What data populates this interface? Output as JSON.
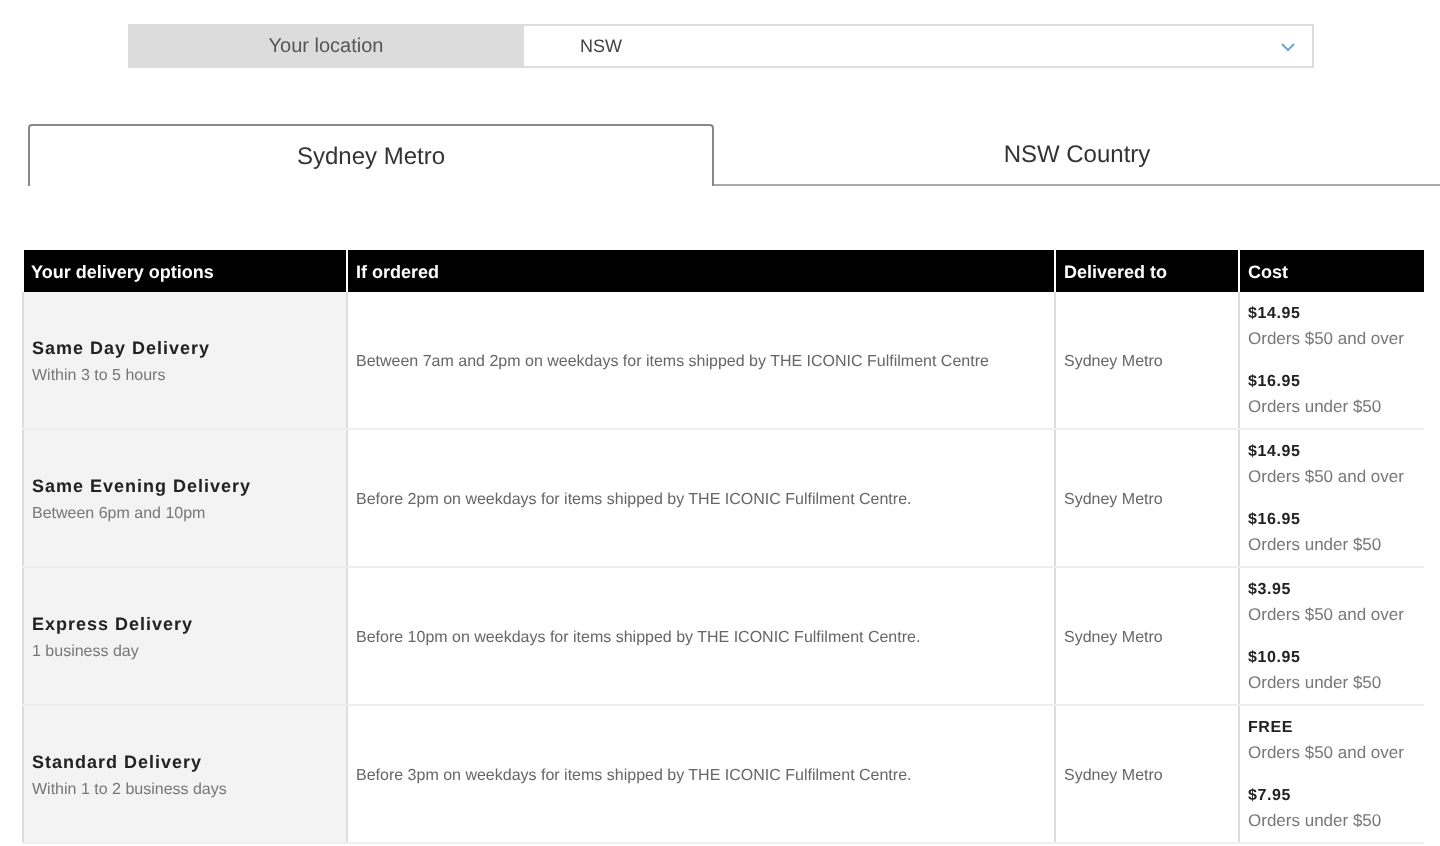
{
  "location": {
    "label": "Your location",
    "value": "NSW"
  },
  "tabs": [
    {
      "label": "Sydney Metro",
      "selected": true
    },
    {
      "label": "NSW Country",
      "selected": false
    }
  ],
  "table": {
    "columns": [
      "Your delivery options",
      "If ordered",
      "Delivered to",
      "Cost"
    ],
    "rows": [
      {
        "option": "Same Day Delivery",
        "timeframe": "Within 3 to 5 hours",
        "if_ordered": "Between 7am and 2pm on weekdays for items shipped by THE ICONIC Fulfilment Centre",
        "delivered_to": "Sydney Metro",
        "costs": [
          {
            "price": "$14.95",
            "condition": "Orders $50 and over"
          },
          {
            "price": "$16.95",
            "condition": "Orders under $50"
          }
        ]
      },
      {
        "option": "Same Evening Delivery",
        "timeframe": "Between 6pm and 10pm",
        "if_ordered": "Before 2pm on weekdays for items shipped by THE ICONIC Fulfilment Centre.",
        "delivered_to": "Sydney Metro",
        "costs": [
          {
            "price": "$14.95",
            "condition": "Orders $50 and over"
          },
          {
            "price": "$16.95",
            "condition": "Orders under $50"
          }
        ]
      },
      {
        "option": "Express Delivery",
        "timeframe": "1 business day",
        "if_ordered": "Before 10pm on weekdays for items shipped by THE ICONIC Fulfilment Centre.",
        "delivered_to": "Sydney Metro",
        "costs": [
          {
            "price": "$3.95",
            "condition": "Orders $50 and over"
          },
          {
            "price": "$10.95",
            "condition": "Orders under $50"
          }
        ]
      },
      {
        "option": "Standard Delivery",
        "timeframe": "Within 1 to 2 business days",
        "if_ordered": "Before 3pm on weekdays for items shipped by THE ICONIC Fulfilment Centre.",
        "delivered_to": "Sydney Metro",
        "costs": [
          {
            "price": "FREE",
            "condition": "Orders $50 and over"
          },
          {
            "price": "$7.95",
            "condition": "Orders under $50"
          }
        ]
      }
    ]
  }
}
